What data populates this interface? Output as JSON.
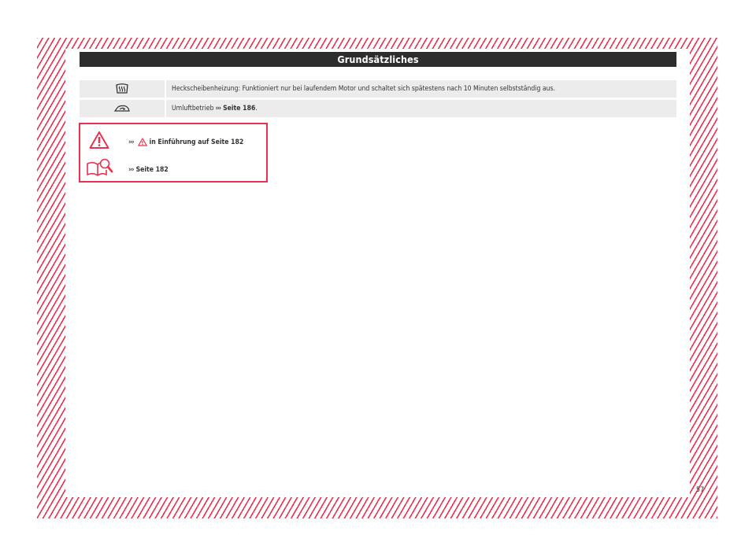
{
  "header": {
    "title": "Grundsätzliches"
  },
  "rows": [
    {
      "icon": "rear-window-defrost-icon",
      "text": "Heckscheibenheizung: Funktioniert nur bei laufendem Motor und schaltet sich spätestens nach 10 Minuten selbstständig aus."
    },
    {
      "icon": "air-recirculation-icon",
      "text": "Umluftbetrieb",
      "arrow": "›››",
      "ref": "Seite 186",
      "suffix": "."
    }
  ],
  "warning_box": {
    "line1": {
      "arrow": "›››",
      "text": "in Einführung auf Seite 182"
    },
    "line2": {
      "arrow": "›››",
      "text": "Seite 182"
    }
  },
  "page_number": "57",
  "colors": {
    "accent": "#e8324f",
    "header_bg": "#2d2d2d",
    "row_bg": "#ececec"
  }
}
